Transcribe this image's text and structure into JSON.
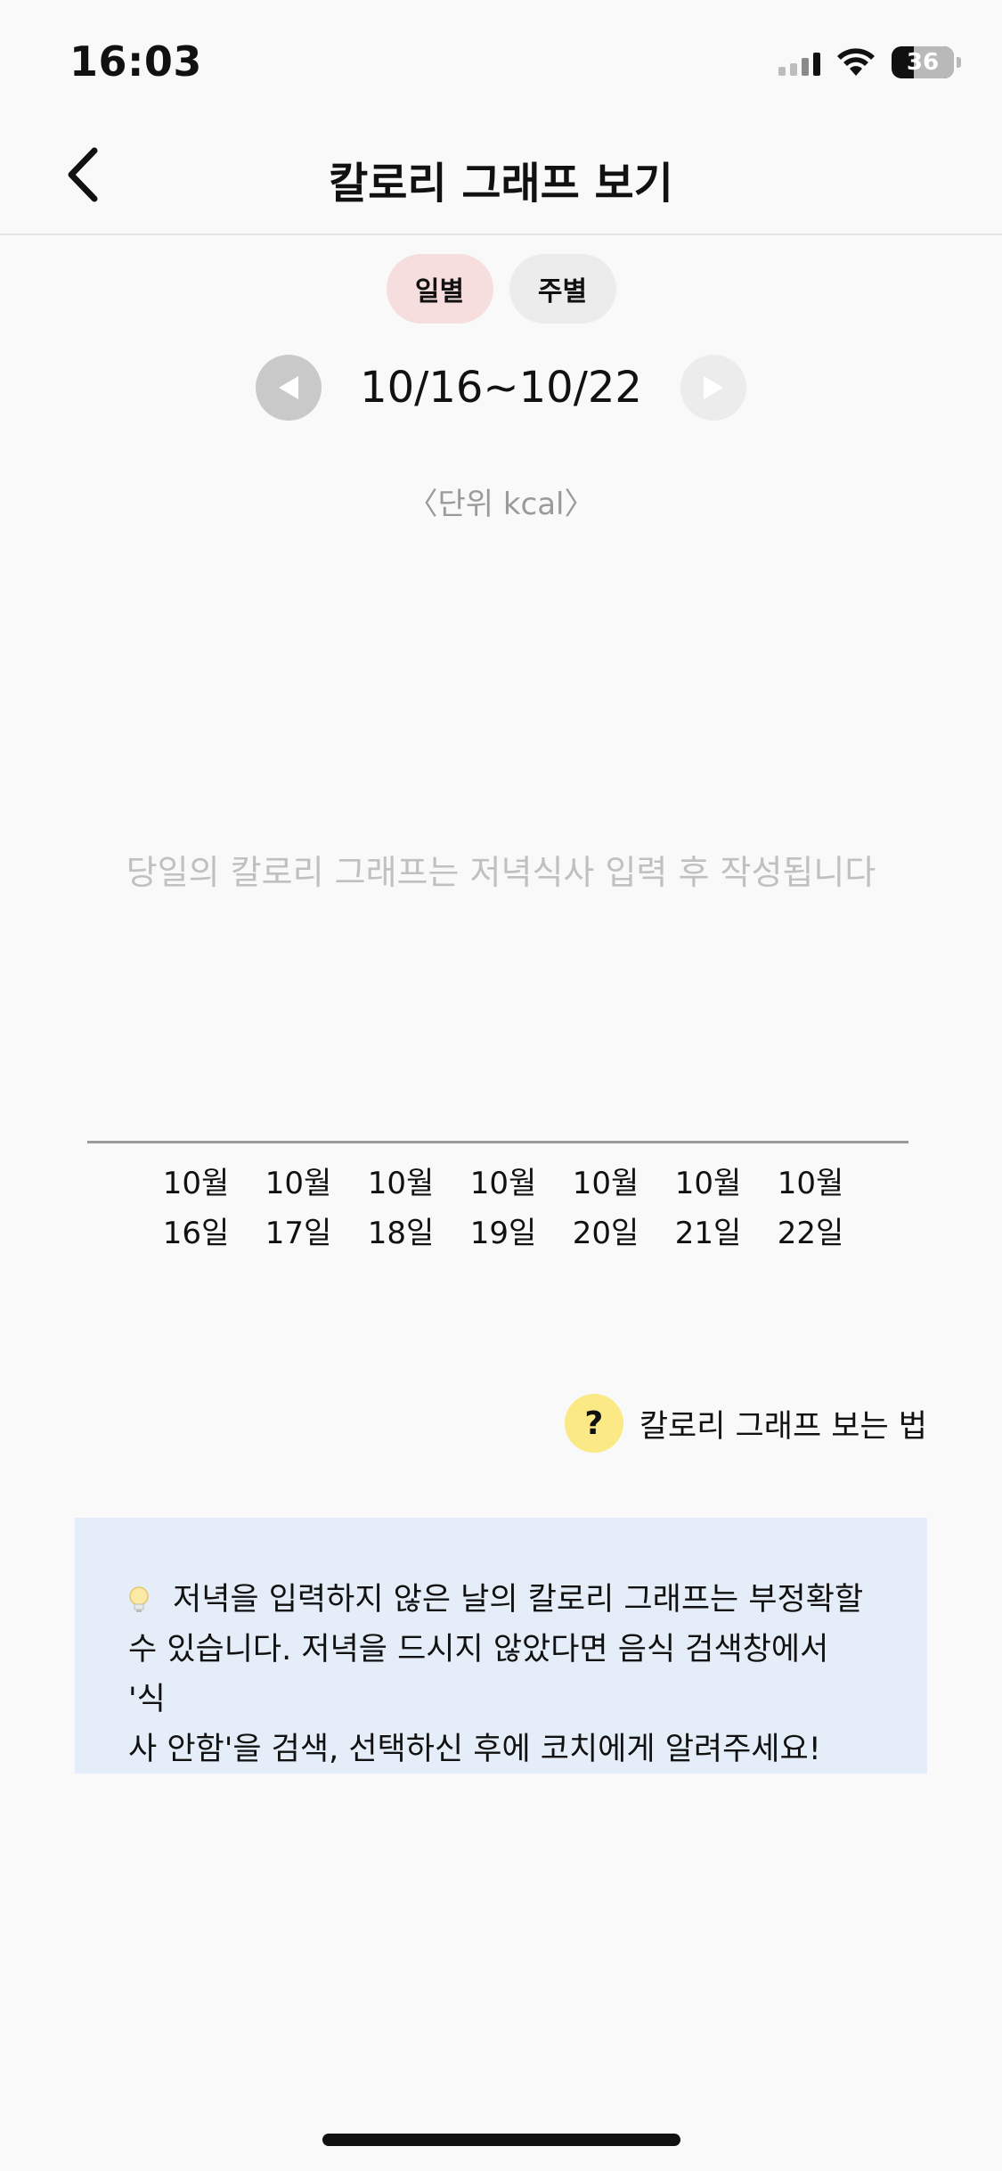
{
  "status_bar": {
    "time": "16:03",
    "battery": "36",
    "battery_level": 0.36
  },
  "header": {
    "title": "칼로리 그래프 보기"
  },
  "tabs": [
    {
      "label": "일별",
      "active": true
    },
    {
      "label": "주별",
      "active": false
    }
  ],
  "date_nav": {
    "range": "10/16~10/22"
  },
  "graph": {
    "unit_label": "〈단위 kcal〉",
    "empty_message": "당일의 칼로리 그래프는 저녁식사 입력 후 작성됩니다",
    "days": [
      {
        "month": "10월",
        "day": "16일"
      },
      {
        "month": "10월",
        "day": "17일"
      },
      {
        "month": "10월",
        "day": "18일"
      },
      {
        "month": "10월",
        "day": "19일"
      },
      {
        "month": "10월",
        "day": "20일"
      },
      {
        "month": "10월",
        "day": "21일"
      },
      {
        "month": "10월",
        "day": "22일"
      }
    ]
  },
  "help": {
    "icon_glyph": "?",
    "label": "칼로리 그래프 보는 법"
  },
  "notice": {
    "line1": "저녁을 입력하지 않은 날의 칼로리 그래프는 부정확할",
    "line2": "수 있습니다. 저녁을 드시지 않았다면 음식 검색창에서 '식",
    "line3": "사 안함'을 검색, 선택하신 후에 코치에게 알려주세요!"
  },
  "colors": {
    "active_tab": "#f7dede",
    "inactive_tab": "#ececec",
    "help_icon": "#fbe985",
    "notice_bg": "#e5eef8",
    "muted_text": "#c0c0c0"
  }
}
